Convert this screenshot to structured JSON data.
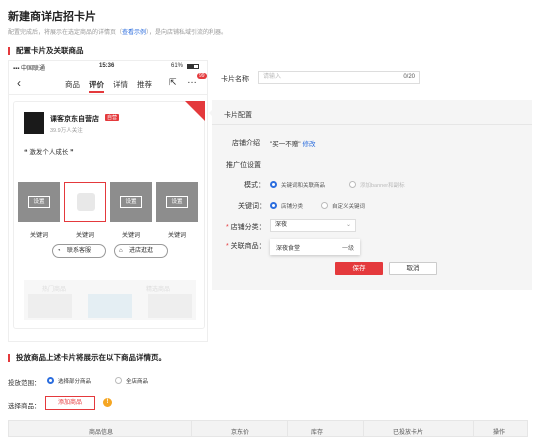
{
  "page": {
    "title": "新建商详店招卡片",
    "desc_prefix": "配置完成后，将展示在选定商品的详情页（",
    "desc_link": "查看示例",
    "desc_suffix": "），是向店铺私域引流的利器。"
  },
  "section1": {
    "title": "配置卡片及关联商品"
  },
  "phone": {
    "carrier": "▪▪▪ 中国联通",
    "time": "15:36",
    "battery": "61%",
    "tabs": [
      "商品",
      "评价",
      "详情",
      "推荐"
    ],
    "active_tab": "评价",
    "badge": "99",
    "shop_name": "课客京东自营店",
    "shop_badge": "自营",
    "fans": "39.9万人关注",
    "slogan": "激发个人成长",
    "product_btn": "设置",
    "keywords": [
      "关键词",
      "关键词",
      "关键词",
      "关键词"
    ],
    "contact_btn": "联系客服",
    "enter_btn": "进店逛逛",
    "faded_labels": [
      "热门商品",
      "精选商品"
    ]
  },
  "form": {
    "card_name_label": "卡片名称",
    "card_name_placeholder": "请输入",
    "card_name_count": "0/20",
    "config_title": "卡片配置",
    "shop_intro_label": "店铺介绍",
    "shop_intro_value": "\"买一不赠\"",
    "shop_intro_edit": "修改",
    "promo_title": "推广位设置",
    "mode_label": "模式：",
    "mode_options": [
      "关键词和关联商品",
      "添加banner和副标"
    ],
    "keyword_label": "关键词：",
    "keyword_options": [
      "店铺分类",
      "自定义关键词"
    ],
    "category_label": "店铺分类：",
    "category_value": "深夜",
    "related_label": "关联商品：",
    "dropdown_item": "深夜食堂",
    "dropdown_level": "一级",
    "save": "保存",
    "cancel": "取消"
  },
  "section2": {
    "title": "投放商品上述卡片将展示在以下商品详情页。",
    "scope_label": "投放范围：",
    "scope_options": [
      "选择部分商品",
      "全店商品"
    ],
    "select_label": "选择商品：",
    "add_button": "添加商品",
    "table_headers": [
      "商品信息",
      "京东价",
      "库存",
      "已投放卡片",
      "操作"
    ]
  },
  "colors": {
    "accent": "#e4393c",
    "link": "#2b6dde"
  }
}
